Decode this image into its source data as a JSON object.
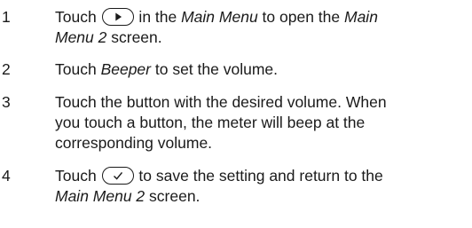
{
  "steps": [
    {
      "number": "1",
      "a": "Touch ",
      "icon": "play-arrow-icon",
      "b": " in the ",
      "i1": "Main Menu",
      "c": " to open the ",
      "i2": "Main",
      "i3": "Menu 2",
      "d": " screen."
    },
    {
      "number": "2",
      "a": "Touch ",
      "i1": "Beeper",
      "b": " to set the volume."
    },
    {
      "number": "3",
      "line1": "Touch the button with the desired volume. When",
      "line2": "you touch a button, the meter will beep at the",
      "line3": "corresponding volume."
    },
    {
      "number": "4",
      "a": "Touch ",
      "icon": "checkmark-icon",
      "b": " to save the setting and return to the",
      "i1": "Main Menu 2",
      "c": " screen."
    }
  ]
}
